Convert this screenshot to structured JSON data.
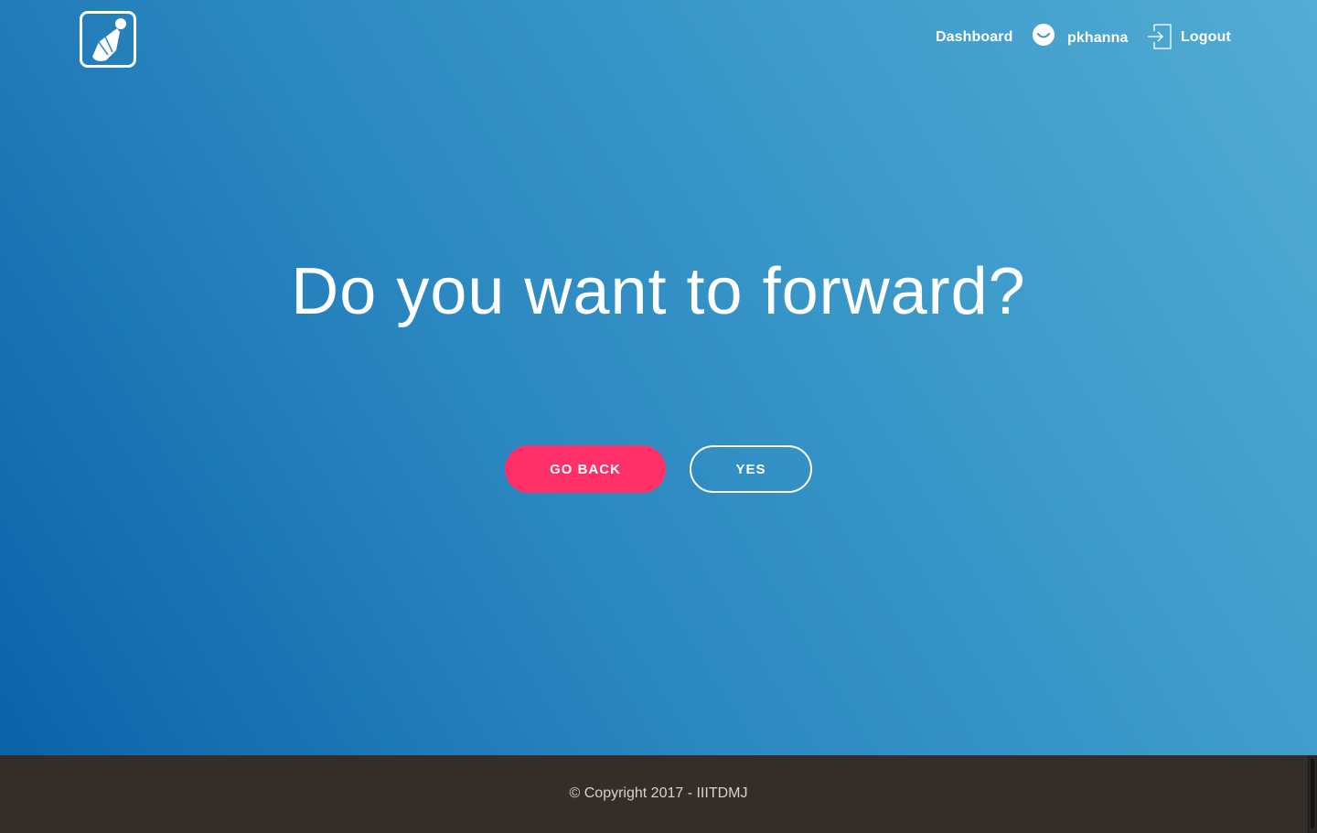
{
  "colors": {
    "accent": "#ff2f68",
    "gradient_start": "#0a63a9",
    "gradient_end": "#52acd3",
    "footer_bg": "#332e29",
    "text_light": "#ffffff"
  },
  "header": {
    "logo_icon": "shuttlecock-icon",
    "nav": {
      "dashboard_label": "Dashboard",
      "user_icon": "smiley-user-icon",
      "username": "pkhanna",
      "logout_icon": "logout-door-icon",
      "logout_label": "Logout"
    }
  },
  "main": {
    "question": "Do you want to forward?",
    "go_back_label": "GO BACK",
    "yes_label": "YES"
  },
  "footer": {
    "copyright": "© Copyright 2017 - IIITDMJ"
  }
}
